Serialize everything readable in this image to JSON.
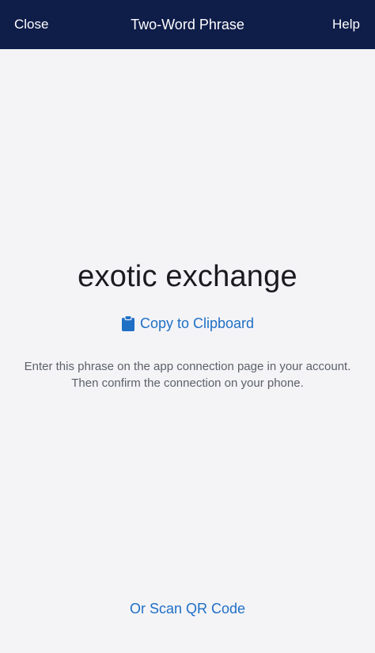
{
  "navbar": {
    "close_label": "Close",
    "title": "Two-Word Phrase",
    "help_label": "Help",
    "background_color": "#0f1d49"
  },
  "main": {
    "phrase": "exotic exchange",
    "copy_label": "Copy to Clipboard",
    "copy_icon": "clipboard-icon",
    "instructions": "Enter this phrase on the app connection page in your account. Then confirm the connection on your phone.",
    "accent_color": "#1f6fc5"
  },
  "footer": {
    "qr_label": "Or Scan QR Code"
  }
}
